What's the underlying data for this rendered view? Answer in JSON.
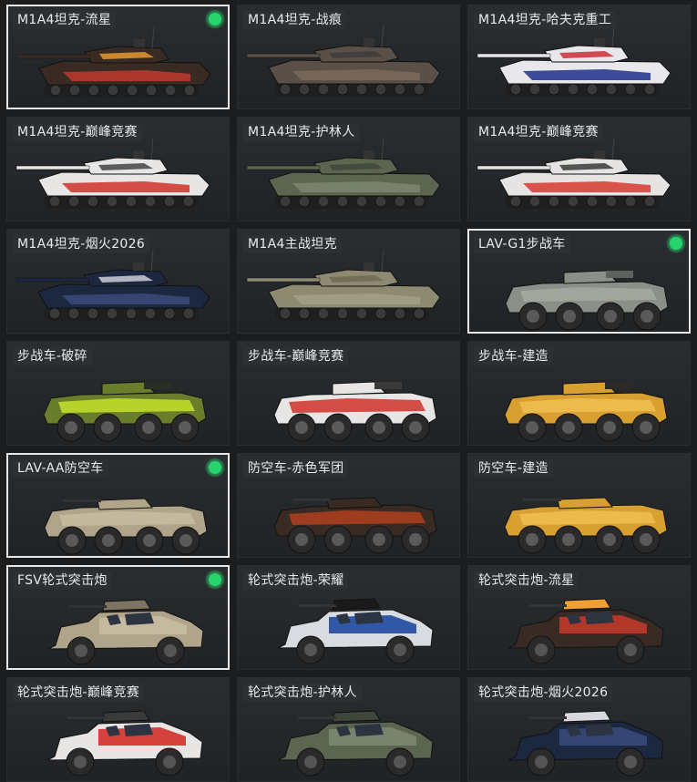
{
  "colors": {
    "equipped_indicator": "#27d36b",
    "selected_border": "#e8e8e8"
  },
  "cards": [
    {
      "name": "M1A4坦克-流星",
      "vehicle": "tank",
      "skin": "meteor",
      "selected": true,
      "equipped": true
    },
    {
      "name": "M1A4坦克-战痕",
      "vehicle": "tank",
      "skin": "scar",
      "selected": false,
      "equipped": false
    },
    {
      "name": "M1A4坦克-哈夫克重工",
      "vehicle": "tank",
      "skin": "haavk",
      "selected": false,
      "equipped": false
    },
    {
      "name": "M1A4坦克-巅峰竞赛",
      "vehicle": "tank",
      "skin": "peak",
      "selected": false,
      "equipped": false
    },
    {
      "name": "M1A4坦克-护林人",
      "vehicle": "tank",
      "skin": "ranger",
      "selected": false,
      "equipped": false
    },
    {
      "name": "M1A4坦克-巅峰竞赛",
      "vehicle": "tank",
      "skin": "peak2",
      "selected": false,
      "equipped": false
    },
    {
      "name": "M1A4坦克-烟火2026",
      "vehicle": "tank",
      "skin": "fireworks",
      "selected": false,
      "equipped": false
    },
    {
      "name": "M1A4主战坦克",
      "vehicle": "tank",
      "skin": "default",
      "selected": false,
      "equipped": false
    },
    {
      "name": "LAV-G1步战车",
      "vehicle": "ifv",
      "skin": "default_grey",
      "selected": true,
      "equipped": true
    },
    {
      "name": "步战车-破碎",
      "vehicle": "ifv",
      "skin": "shatter",
      "selected": false,
      "equipped": false
    },
    {
      "name": "步战车-巅峰竞赛",
      "vehicle": "ifv",
      "skin": "peak",
      "selected": false,
      "equipped": false
    },
    {
      "name": "步战车-建造",
      "vehicle": "ifv",
      "skin": "construct",
      "selected": false,
      "equipped": false
    },
    {
      "name": "LAV-AA防空车",
      "vehicle": "aa",
      "skin": "default_sand",
      "selected": true,
      "equipped": true
    },
    {
      "name": "防空车-赤色军团",
      "vehicle": "aa",
      "skin": "red_legion",
      "selected": false,
      "equipped": false
    },
    {
      "name": "防空车-建造",
      "vehicle": "aa",
      "skin": "construct",
      "selected": false,
      "equipped": false
    },
    {
      "name": "FSV轮式突击炮",
      "vehicle": "fsv",
      "skin": "default_sand",
      "selected": true,
      "equipped": true
    },
    {
      "name": "轮式突击炮-荣耀",
      "vehicle": "fsv",
      "skin": "glory",
      "selected": false,
      "equipped": false
    },
    {
      "name": "轮式突击炮-流星",
      "vehicle": "fsv",
      "skin": "meteor",
      "selected": false,
      "equipped": false
    },
    {
      "name": "轮式突击炮-巅峰竞赛",
      "vehicle": "fsv",
      "skin": "peak",
      "selected": false,
      "equipped": false
    },
    {
      "name": "轮式突击炮-护林人",
      "vehicle": "fsv",
      "skin": "ranger",
      "selected": false,
      "equipped": false
    },
    {
      "name": "轮式突击炮-烟火2026",
      "vehicle": "fsv",
      "skin": "fireworks",
      "selected": false,
      "equipped": false
    }
  ],
  "skin_colors": {
    "meteor": [
      "#3a2a24",
      "#c0392b",
      "#f0a030"
    ],
    "scar": [
      "#5a5048",
      "#7a6a5c",
      "#3c3a38"
    ],
    "haavk": [
      "#e8e8ec",
      "#1f2f8a",
      "#c8202a"
    ],
    "peak": [
      "#e8e6e4",
      "#d0302a",
      "#3a3a3a"
    ],
    "peak2": [
      "#e6e4e2",
      "#d63a30",
      "#2e2e2e"
    ],
    "ranger": [
      "#5c6550",
      "#7d8670",
      "#3f463a"
    ],
    "fireworks": [
      "#1c2740",
      "#3a4a7a",
      "#d8d8e0"
    ],
    "default": [
      "#8e8a72",
      "#a49f86",
      "#6a6754"
    ],
    "default_grey": [
      "#8a9088",
      "#a4aaa2",
      "#5e625c"
    ],
    "shatter": [
      "#6a7d2a",
      "#c4e02c",
      "#2a2e24"
    ],
    "construct": [
      "#d8a030",
      "#f0c050",
      "#2c2a26"
    ],
    "default_sand": [
      "#b0a48a",
      "#c8bca2",
      "#7e7462"
    ],
    "red_legion": [
      "#3a2a24",
      "#b04020",
      "#6a4a3a"
    ],
    "glory": [
      "#d8dce0",
      "#2048a0",
      "#1a1a1a"
    ]
  }
}
